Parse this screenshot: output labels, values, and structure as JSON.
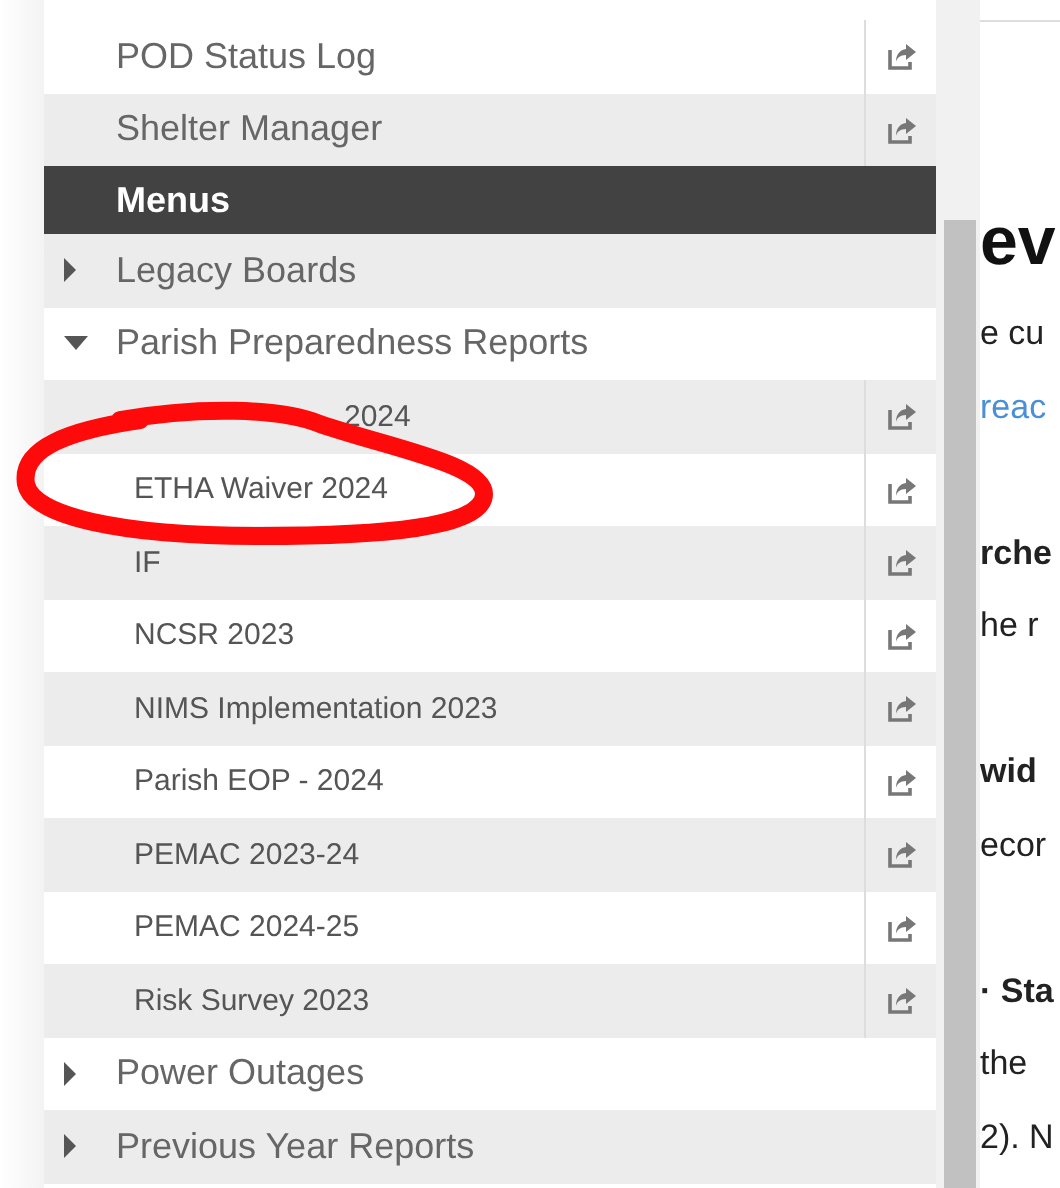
{
  "menu": {
    "items": [
      {
        "kind": "link",
        "label": "POD Status Log"
      },
      {
        "kind": "link",
        "label": "Shelter Manager"
      },
      {
        "kind": "header",
        "label": "Menus"
      },
      {
        "kind": "folder",
        "label": "Legacy Boards",
        "expanded": false
      },
      {
        "kind": "folder",
        "label": "Parish Preparedness Reports",
        "expanded": true,
        "children": [
          {
            "kind": "covered_start",
            "label": "2024"
          },
          {
            "kind": "plain",
            "label": "ETHA Waiver 2024"
          },
          {
            "kind": "plain",
            "label": "IF"
          },
          {
            "kind": "plain",
            "label": "NCSR 2023"
          },
          {
            "kind": "plain",
            "label": "NIMS Implementation 2023"
          },
          {
            "kind": "plain",
            "label": "Parish EOP - 2024"
          },
          {
            "kind": "plain",
            "label": "PEMAC 2023-24"
          },
          {
            "kind": "plain",
            "label": "PEMAC 2024-25"
          },
          {
            "kind": "plain",
            "label": "Risk Survey 2023"
          }
        ]
      },
      {
        "kind": "folder",
        "label": "Power Outages",
        "expanded": false
      },
      {
        "kind": "folder",
        "label": "Previous Year Reports",
        "expanded": false
      }
    ]
  },
  "content": {
    "lines": [
      {
        "kind": "heading",
        "text": "ev"
      },
      {
        "kind": "text",
        "text": "e cu"
      },
      {
        "kind": "link",
        "text": "reac"
      },
      {
        "kind": "gap"
      },
      {
        "kind": "bold",
        "text": "rche"
      },
      {
        "kind": "text",
        "text": "he r"
      },
      {
        "kind": "gap"
      },
      {
        "kind": "bold",
        "text": "wid"
      },
      {
        "kind": "text",
        "text": "ecor"
      },
      {
        "kind": "gap"
      },
      {
        "kind": "bold",
        "text": "· Sta"
      },
      {
        "kind": "text",
        "text": "the"
      },
      {
        "kind": "text",
        "text": "2). N"
      }
    ]
  }
}
